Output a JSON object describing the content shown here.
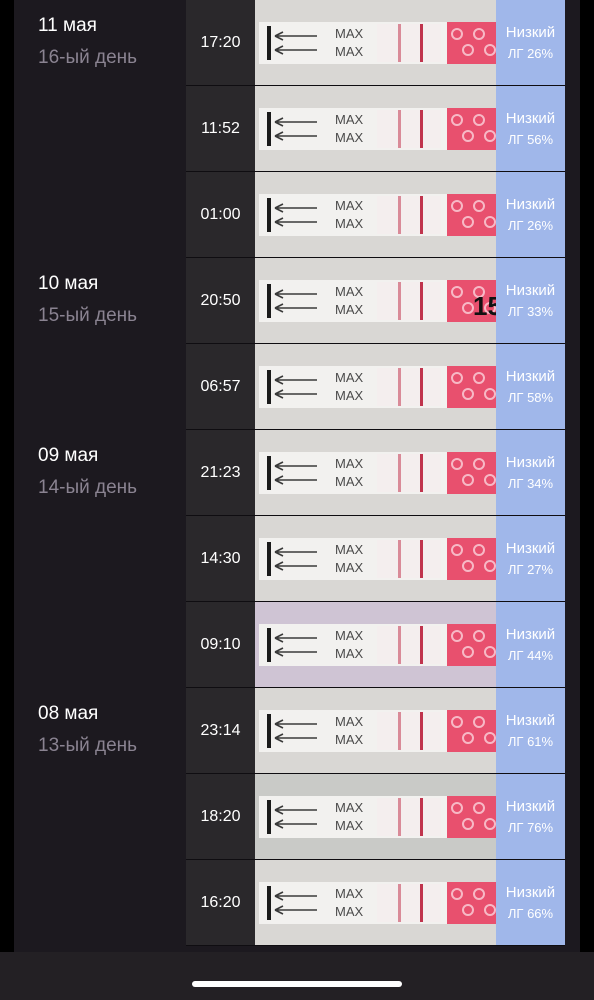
{
  "groups": [
    {
      "date": "11 мая",
      "day": "16-ый день"
    },
    {
      "date": "10 мая",
      "day": "15-ый день"
    },
    {
      "date": "09 мая",
      "day": "14-ый день"
    },
    {
      "date": "08 мая",
      "day": "13-ый день"
    }
  ],
  "entries": [
    {
      "time": "17:20",
      "level": "Низкий",
      "lh": "ЛГ 26%",
      "max_label": "MAX"
    },
    {
      "time": "11:52",
      "level": "Низкий",
      "lh": "ЛГ 56%",
      "max_label": "MAX"
    },
    {
      "time": "01:00",
      "level": "Низкий",
      "lh": "ЛГ 26%",
      "max_label": "MAX"
    },
    {
      "time": "20:50",
      "level": "Низкий",
      "lh": "ЛГ 33%",
      "max_label": "MAX",
      "marker": "15"
    },
    {
      "time": "06:57",
      "level": "Низкий",
      "lh": "ЛГ 58%",
      "max_label": "MAX"
    },
    {
      "time": "21:23",
      "level": "Низкий",
      "lh": "ЛГ 34%",
      "max_label": "MAX"
    },
    {
      "time": "14:30",
      "level": "Низкий",
      "lh": "ЛГ 27%",
      "max_label": "MAX"
    },
    {
      "time": "09:10",
      "level": "Низкий",
      "lh": "ЛГ 44%",
      "max_label": "MAX"
    },
    {
      "time": "23:14",
      "level": "Низкий",
      "lh": "ЛГ 61%",
      "max_label": "MAX"
    },
    {
      "time": "18:20",
      "level": "Низкий",
      "lh": "ЛГ 76%",
      "max_label": "MAX"
    },
    {
      "time": "16:20",
      "level": "Низкий",
      "lh": "ЛГ 66%",
      "max_label": "MAX"
    }
  ],
  "colors": {
    "background": "#1c191f",
    "time_cell": "#2a282b",
    "result_cell": "#a0b7ea",
    "day_text": "#8a8391",
    "strip_pink": "#e8506e"
  }
}
